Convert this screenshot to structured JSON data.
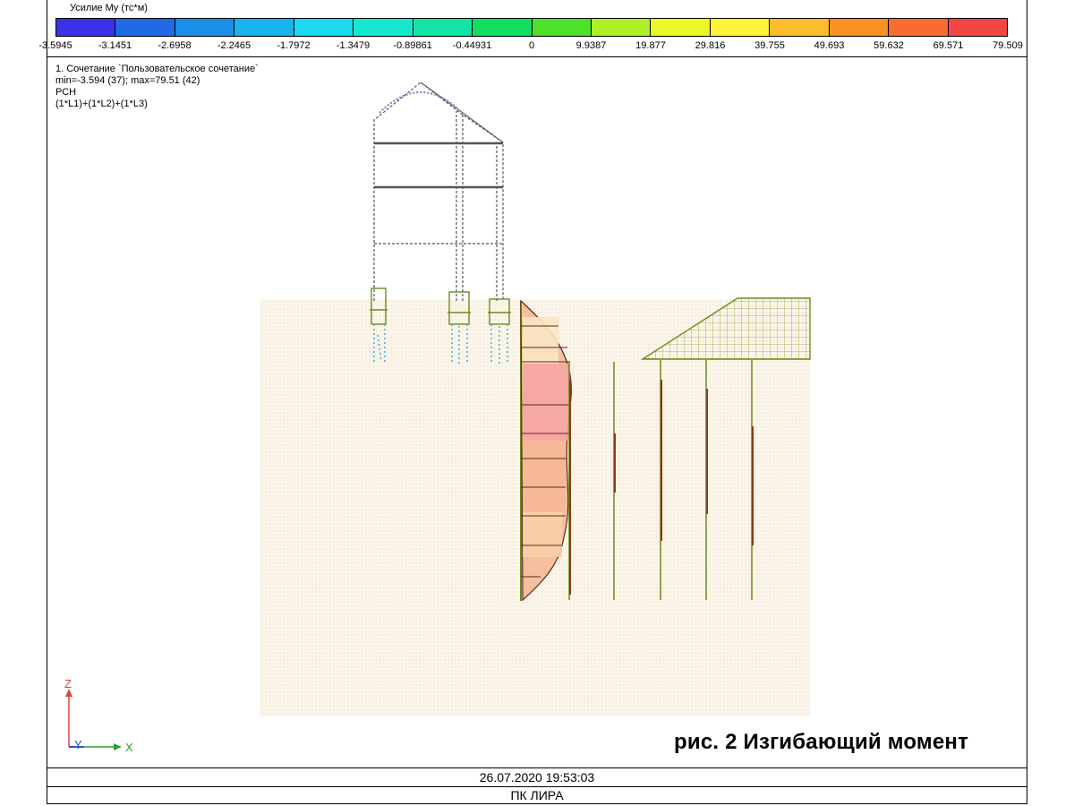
{
  "legend": {
    "title": "Усилие My (тс*м)",
    "colors": [
      "#3b33e8",
      "#1f6ae5",
      "#1b8fe8",
      "#19b4ee",
      "#1bd9ee",
      "#18e7cf",
      "#14e3a6",
      "#12dd5e",
      "#4fe02a",
      "#aef027",
      "#eaf729",
      "#fff23a",
      "#fdbc2c",
      "#fb9120",
      "#f96c2f",
      "#f54646"
    ],
    "ticks": [
      "-3.5945",
      "-3.1451",
      "-2.6958",
      "-2.2465",
      "-1.7972",
      "-1.3479",
      "-0.89861",
      "-0.44931",
      "0",
      "9.9387",
      "19.877",
      "29.816",
      "39.755",
      "49.693",
      "59.632",
      "69.571",
      "79.509"
    ]
  },
  "info": {
    "line1": "1. Сочетание `Пользовательское сочетание`",
    "line2": "min=-3.594 (37); max=79.51 (42)",
    "line3": "РСН",
    "line4": "(1*L1)+(1*L2)+(1*L3)"
  },
  "axes": {
    "z": "Z",
    "y": "Y",
    "x": "X"
  },
  "caption": "рис. 2 Изгибающий момент",
  "footer": {
    "timestamp": "26.07.2020 19:53:03",
    "app": "ПК ЛИРА"
  }
}
